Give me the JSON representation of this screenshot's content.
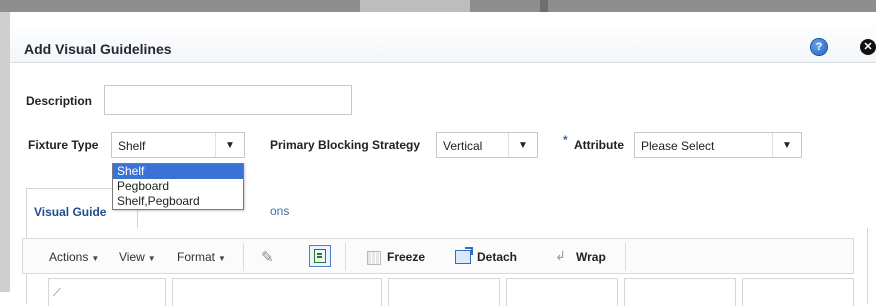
{
  "dialog": {
    "title": "Add Visual Guidelines",
    "help_icon": "question-circle-icon",
    "close_icon": "close-circle-icon"
  },
  "form": {
    "description": {
      "label": "Description",
      "value": ""
    },
    "fixture_type": {
      "label": "Fixture Type",
      "selected": "Shelf",
      "options": [
        "Shelf",
        "Pegboard",
        "Shelf,Pegboard"
      ],
      "dropdown_open": true
    },
    "primary_blocking": {
      "label": "Primary Blocking Strategy",
      "selected": "Vertical"
    },
    "attribute": {
      "label": "Attribute",
      "required_marker": "*",
      "selected": "Please Select"
    }
  },
  "tabs": [
    {
      "label": "Visual Guide",
      "active": true
    },
    {
      "label": "ons",
      "active": false
    }
  ],
  "toolbar": {
    "actions": "Actions",
    "view": "View",
    "format": "Format",
    "freeze": "Freeze",
    "detach": "Detach",
    "wrap": "Wrap",
    "icons": [
      "pencil-icon",
      "edit-record-icon",
      "freeze-icon",
      "detach-icon",
      "wrap-icon"
    ]
  },
  "colors": {
    "accent": "#2d6fc7",
    "selected_option": "#3a72d6",
    "tab_text": "#214f8a"
  }
}
